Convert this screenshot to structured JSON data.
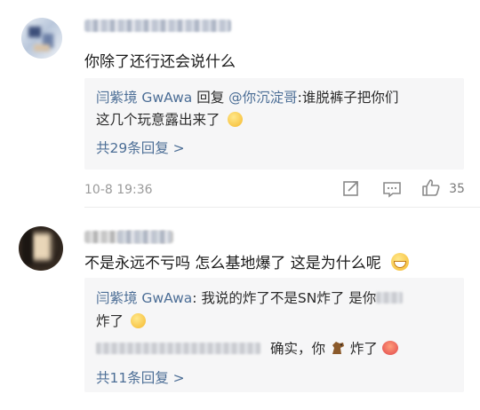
{
  "comments": [
    {
      "text": "你除了还行还会说什么",
      "reply_preview": {
        "author": "闫紫境 GwAwa",
        "verb": "回复",
        "mention": "@你沉淀哥",
        "line1_rest": ":谁脱裤子把你们",
        "line2": "这几个玩意露出来了",
        "emoji": "shy-face-emoji"
      },
      "more_replies": "共29条回复 >",
      "time": "10-8 19:36",
      "like_count": "35"
    },
    {
      "text": "不是永远不亏吗 怎么基地爆了 这是为什么呢",
      "text_emoji": "grin-emoji",
      "reply_preview": {
        "author": "闫紫境 GwAwa",
        "line1_rest": ": 我说的炸了不是SN炸了 是你",
        "line2": "炸了",
        "line2_emoji": "laughing-face-emoji",
        "line3_text": "确实，你",
        "line3_emoji1": "horse-emoji",
        "line3_text2": "炸了",
        "line3_emoji2": "red-face-emoji"
      },
      "more_replies": "共11条回复 >"
    }
  ],
  "icons": {
    "share": "share-icon",
    "comment": "comment-icon",
    "like": "thumbs-up-icon"
  },
  "colors": {
    "link": "#4c6e96",
    "reply_bg": "#f6f6f7",
    "meta": "#9a9a9a"
  }
}
